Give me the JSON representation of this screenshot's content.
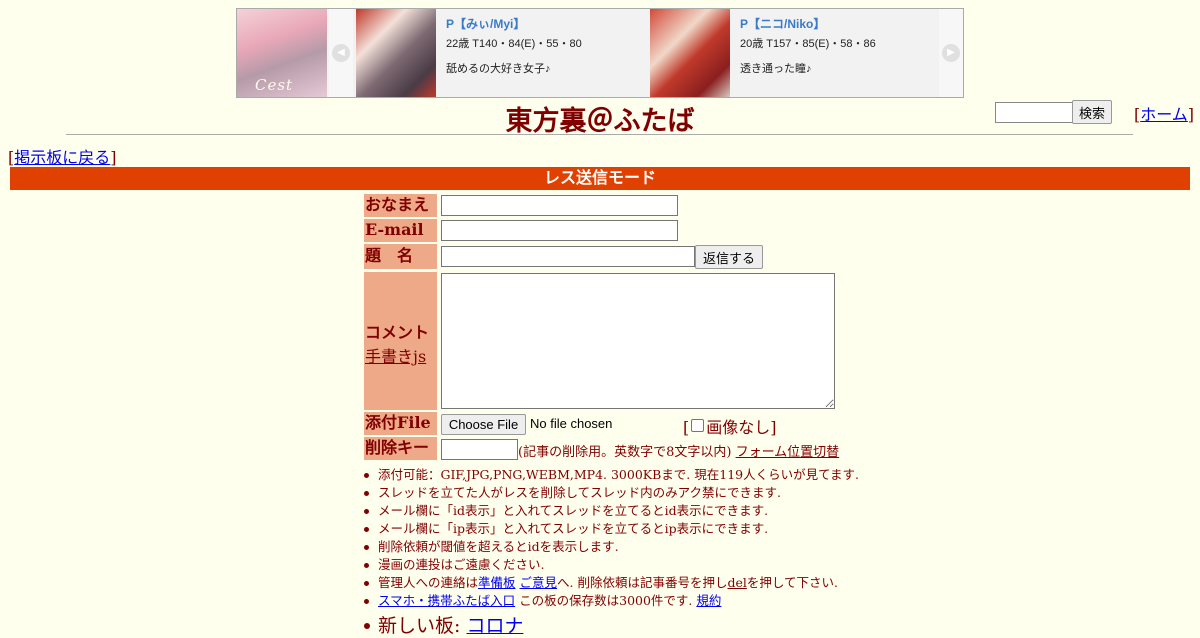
{
  "ad_banner": {
    "logo_text": "Cest",
    "prev_arrow": "◀",
    "next_arrow": "▶",
    "cards": [
      {
        "name": "P【みぃ/Myi】",
        "meta": "22歳 T140・84(E)・55・80",
        "desc": "舐めるの大好き女子♪"
      },
      {
        "name": "P【ニコ/Niko】",
        "meta": "20歳 T157・85(E)・58・86",
        "desc": "透き通った瞳♪"
      }
    ]
  },
  "header": {
    "title": "東方裏＠ふたば",
    "search_button": "検索",
    "home_link": "ホーム",
    "back_link": "掲示板に戻る"
  },
  "mode_bar": "レス送信モード",
  "form": {
    "name_label": "おなまえ",
    "email_label": "E-mail",
    "subject_label": "題　名",
    "submit_button": "返信する",
    "comment_label": "コメント",
    "handwrite_link": "手書きjs",
    "file_label": "添付File",
    "choose_file_button": "Choose File",
    "file_status": "No file chosen",
    "no_image_label": "画像なし",
    "delkey_label": "削除キー",
    "delkey_note": "(記事の削除用。英数字で8文字以内)",
    "form_switch_link": "フォーム位置切替"
  },
  "notes": {
    "n1": "添付可能：GIF,JPG,PNG,WEBM,MP4. 3000KBまで. 現在119人くらいが見てます.",
    "n2": "スレッドを立てた人がレスを削除してスレッド内のみアク禁にできます.",
    "n3": "メール欄に「id表示」と入れてスレッドを立てるとid表示にできます.",
    "n4": "メール欄に「ip表示」と入れてスレッドを立てるとip表示にできます.",
    "n5": "削除依頼が閾値を超えるとidを表示します.",
    "n6": "漫画の連投はご遠慮ください.",
    "n7_prefix": "管理人への連絡は",
    "n7_link1": "準備板",
    "n7_link2": "ご意見",
    "n7_mid": "へ. 削除依頼は記事番号を押し",
    "n7_link3": "del",
    "n7_suffix": "を押して下さい.",
    "n8_link": "スマホ・携帯ふたば入口",
    "n8_mid": " この板の保存数は3000件です. ",
    "n8_link2": "規約",
    "new_board_label": "新しい板: ",
    "new_board_link": "コロナ"
  }
}
